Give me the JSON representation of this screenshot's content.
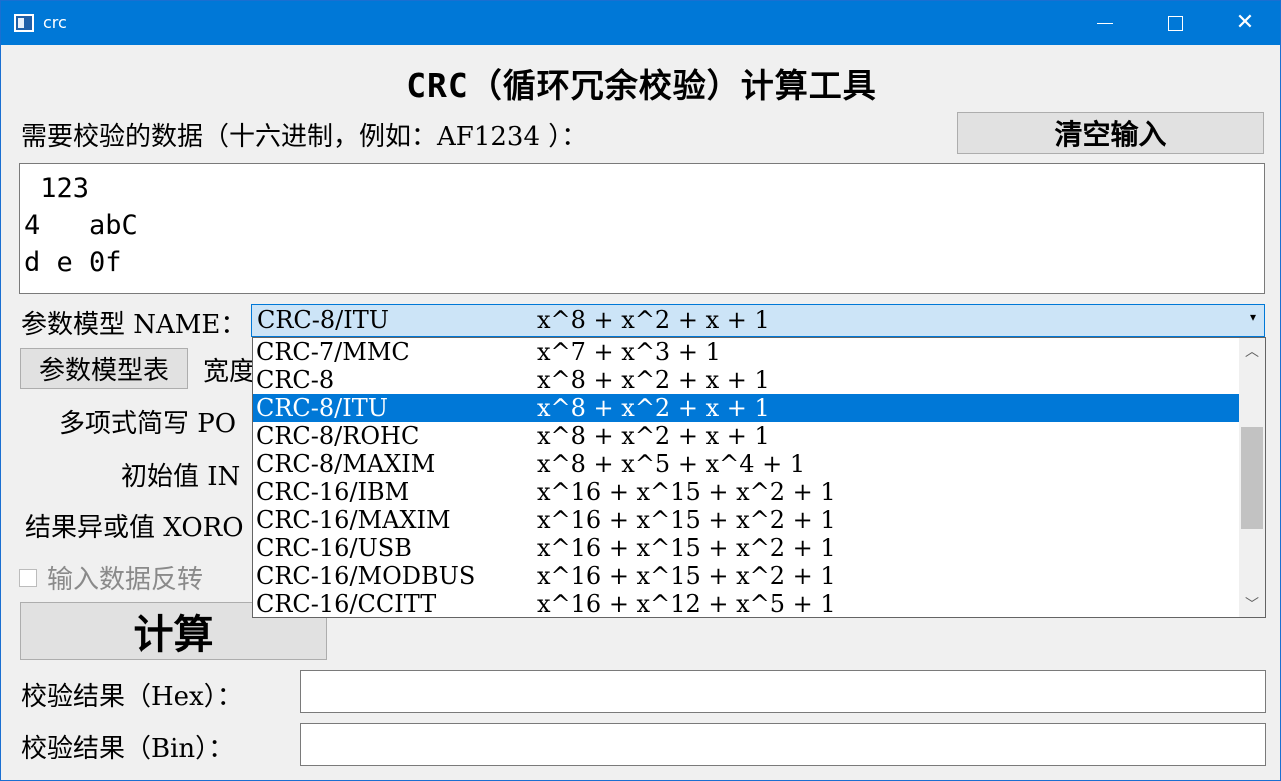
{
  "window": {
    "title": "crc"
  },
  "header": {
    "title": "CRC（循环冗余校验）计算工具"
  },
  "input": {
    "label": "需要校验的数据（十六进制，例如：AF1234 ）：",
    "clear_button": "清空输入",
    "value": " 123\n4   abC\nd e 0f"
  },
  "model": {
    "label": "参数模型 NAME：",
    "selected_name": "CRC-8/ITU",
    "selected_poly": "x^8 + x^2 + x + 1",
    "table_button": "参数模型表",
    "options": [
      {
        "name": "CRC-7/MMC",
        "poly": "x^7 + x^3 + 1"
      },
      {
        "name": "CRC-8",
        "poly": "x^8 + x^2 + x + 1"
      },
      {
        "name": "CRC-8/ITU",
        "poly": "x^8 + x^2 + x + 1"
      },
      {
        "name": "CRC-8/ROHC",
        "poly": "x^8 + x^2 + x + 1"
      },
      {
        "name": "CRC-8/MAXIM",
        "poly": "x^8 + x^5 + x^4 + 1"
      },
      {
        "name": "CRC-16/IBM",
        "poly": "x^16 + x^15 + x^2 + 1"
      },
      {
        "name": "CRC-16/MAXIM",
        "poly": "x^16 + x^15 + x^2 + 1"
      },
      {
        "name": "CRC-16/USB",
        "poly": "x^16 + x^15 + x^2 + 1"
      },
      {
        "name": "CRC-16/MODBUS",
        "poly": "x^16 + x^15 + x^2 + 1"
      },
      {
        "name": "CRC-16/CCITT",
        "poly": "x^16 + x^12 + x^5 + 1"
      }
    ]
  },
  "params": {
    "width_label": "宽度",
    "poly_label": "多项式简写 PO",
    "init_label": "初始值 IN",
    "xorout_label": "结果异或值 XORO",
    "refin_label": "输入数据反转"
  },
  "actions": {
    "calculate": "计算"
  },
  "results": {
    "hex_label": "校验结果（Hex）：",
    "hex_value": "",
    "bin_label": "校验结果（Bin）：",
    "bin_value": ""
  },
  "icons": {
    "dropdown_arrow": "▾",
    "scroll_up": "︿",
    "scroll_down": "﹀",
    "close": "✕"
  }
}
